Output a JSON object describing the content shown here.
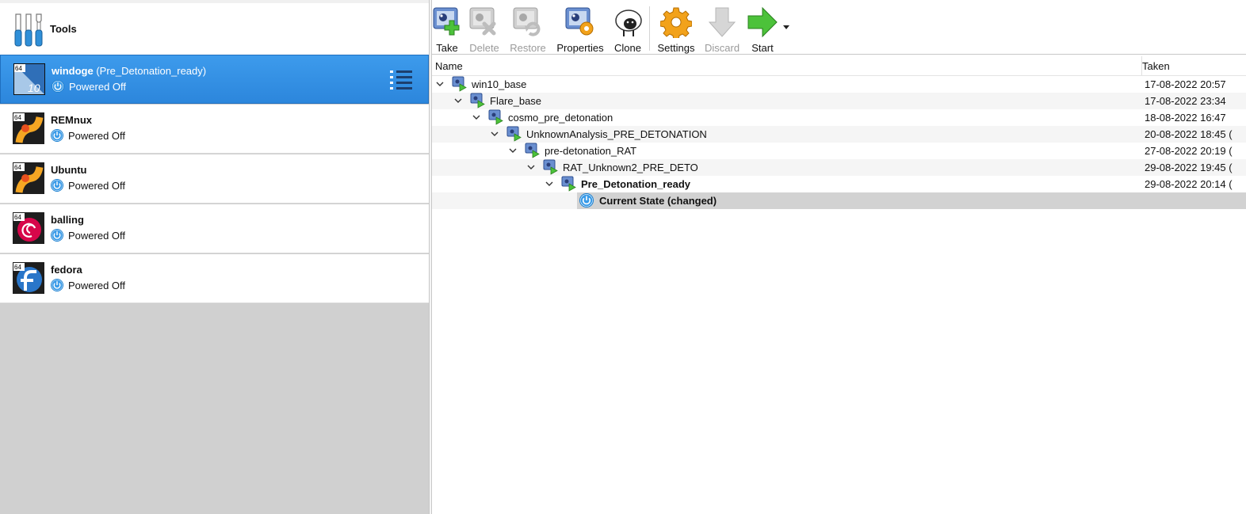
{
  "left_panel": {
    "tools_label": "Tools",
    "vms": [
      {
        "name": "windoge",
        "snapshot": "(Pre_Detonation_ready)",
        "status": "Powered Off",
        "icon": "windows10-64-icon",
        "badge": "64",
        "sub_badge": "10",
        "selected": true
      },
      {
        "name": "REMnux",
        "snapshot": "",
        "status": "Powered Off",
        "icon": "ubuntu-64-icon",
        "badge": "64",
        "selected": false
      },
      {
        "name": "Ubuntu",
        "snapshot": "",
        "status": "Powered Off",
        "icon": "ubuntu-64-icon",
        "badge": "64",
        "selected": false
      },
      {
        "name": "balling",
        "snapshot": "",
        "status": "Powered Off",
        "icon": "debian-64-icon",
        "badge": "64",
        "selected": false
      },
      {
        "name": "fedora",
        "snapshot": "",
        "status": "Powered Off",
        "icon": "fedora-64-icon",
        "badge": "64",
        "selected": false
      }
    ]
  },
  "toolbar": {
    "buttons": [
      {
        "label": "Take",
        "icon": "take-snapshot-icon",
        "enabled": true
      },
      {
        "label": "Delete",
        "icon": "delete-snapshot-icon",
        "enabled": false
      },
      {
        "label": "Restore",
        "icon": "restore-snapshot-icon",
        "enabled": false
      },
      {
        "label": "Properties",
        "icon": "snapshot-properties-icon",
        "enabled": true
      },
      {
        "label": "Clone",
        "icon": "clone-sheep-icon",
        "enabled": true
      },
      {
        "label": "Settings",
        "icon": "settings-gear-icon",
        "enabled": true
      },
      {
        "label": "Discard",
        "icon": "discard-arrow-icon",
        "enabled": false
      },
      {
        "label": "Start",
        "icon": "start-arrow-icon",
        "enabled": true
      }
    ]
  },
  "snapshot_tree": {
    "columns": {
      "name": "Name",
      "taken": "Taken"
    },
    "rows": [
      {
        "name": "win10_base",
        "taken": "17-08-2022 20:57",
        "depth": 0
      },
      {
        "name": "Flare_base",
        "taken": "17-08-2022 23:34",
        "depth": 1
      },
      {
        "name": "cosmo_pre_detonation",
        "taken": "18-08-2022 16:47",
        "depth": 2
      },
      {
        "name": "UnknownAnalysis_PRE_DETONATION",
        "taken": "20-08-2022 18:45 (",
        "depth": 3
      },
      {
        "name": "pre-detonation_RAT",
        "taken": "27-08-2022 20:19 (",
        "depth": 4
      },
      {
        "name": "RAT_Unknown2_PRE_DETO",
        "taken": "29-08-2022 19:45 (",
        "depth": 5
      },
      {
        "name": "Pre_Detonation_ready",
        "taken": "29-08-2022 20:14 (",
        "depth": 6,
        "bold": true
      }
    ],
    "current_state": "Current State (changed)"
  },
  "colors": {
    "selection_blue": "#2c86dc",
    "panel_gray": "#d0d0d0",
    "start_green": "#3fbf1f",
    "settings_orange": "#f2a21b"
  }
}
